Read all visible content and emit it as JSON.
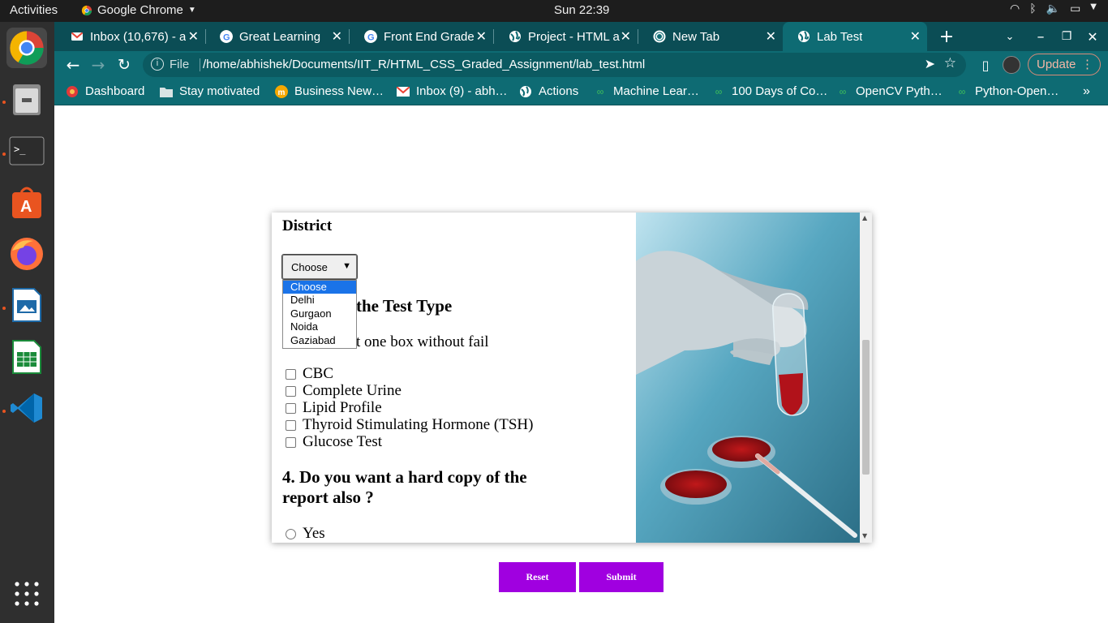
{
  "system_bar": {
    "activities": "Activities",
    "app_name": "Google Chrome",
    "clock": "Sun 22:39"
  },
  "dock": {
    "items": [
      "chrome-icon",
      "files-icon",
      "terminal-icon",
      "software-center-icon",
      "firefox-icon",
      "impress-icon",
      "calc-icon",
      "vscode-icon",
      "app-grid-icon"
    ]
  },
  "tabs": [
    {
      "title": "Inbox (10,676) - a",
      "favicon": "gmail-icon"
    },
    {
      "title": "Great Learning",
      "favicon": "google-icon"
    },
    {
      "title": "Front End Grade",
      "favicon": "google-icon"
    },
    {
      "title": "Project - HTML a",
      "favicon": "globe-icon"
    },
    {
      "title": "New Tab",
      "favicon": "chrome-icon"
    },
    {
      "title": "Lab Test",
      "favicon": "globe-icon"
    }
  ],
  "toolbar": {
    "scheme": "File",
    "url": "/home/abhishek/Documents/IIT_R/HTML_CSS_Graded_Assignment/lab_test.html",
    "update_label": "Update"
  },
  "bookmarks": [
    {
      "label": "Dashboard",
      "icon": "dashboard-icon"
    },
    {
      "label": "Stay motivated",
      "icon": "folder-icon"
    },
    {
      "label": "Business New…",
      "icon": "business-icon"
    },
    {
      "label": "Inbox (9) - abh…",
      "icon": "gmail-icon"
    },
    {
      "label": "Actions",
      "icon": "globe-icon"
    },
    {
      "label": "Machine Lear…",
      "icon": "link-icon"
    },
    {
      "label": "100 Days of Co…",
      "icon": "link-icon"
    },
    {
      "label": "OpenCV Pyth…",
      "icon": "link-icon"
    },
    {
      "label": "Python-Open…",
      "icon": "link-icon"
    }
  ],
  "form": {
    "district_label": "District",
    "district_selected": "Choose",
    "district_options": [
      "Choose",
      "Delhi",
      "Gurgaon",
      "Noida",
      "Gaziabad"
    ],
    "test_type_heading_visible": "the Test Type",
    "test_type_hint_visible": "t one box without fail",
    "tests": [
      "CBC",
      "Complete Urine",
      "Lipid Profile",
      "Thyroid Stimulating Hormone (TSH)",
      "Glucose Test"
    ],
    "hardcopy_line1": "4. Do you want a hard copy of the",
    "hardcopy_line2": "report also ?",
    "hardcopy_options": [
      "Yes"
    ]
  },
  "buttons": {
    "reset": "Reset",
    "submit": "Submit"
  },
  "colors": {
    "chrome_theme": "#0e6b73",
    "button": "#a000e0",
    "dropdown_highlight": "#1a73e8"
  }
}
